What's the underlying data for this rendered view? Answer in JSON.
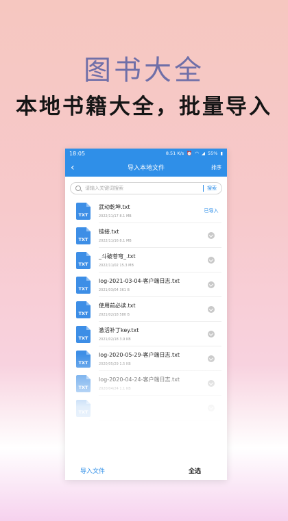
{
  "promo": {
    "title": "图书大全",
    "subtitle": "本地书籍大全，批量导入"
  },
  "status_bar": {
    "time": "18:05",
    "speed": "8.51 K/s",
    "battery": "55%"
  },
  "nav": {
    "back_icon": "chevron-left-icon",
    "title": "导入本地文件",
    "sort_label": "排序"
  },
  "search": {
    "placeholder": "请输入关键词搜索",
    "button_label": "搜索"
  },
  "files": [
    {
      "icon_label": "TXT",
      "name": "武动乾坤.txt",
      "meta": "2022/11/17  8.1 MB",
      "status": "imported",
      "status_label": "已导入"
    },
    {
      "icon_label": "TXT",
      "name": "链接.txt",
      "meta": "2022/11/16  8.1 MB",
      "status": "check"
    },
    {
      "icon_label": "TXT",
      "name": "_斗破苍穹_.txt",
      "meta": "2022/11/02  15.3 MB",
      "status": "check"
    },
    {
      "icon_label": "TXT",
      "name": "log-2021-03-04-客户端日志.txt",
      "meta": "2021/03/04  361 B",
      "status": "check"
    },
    {
      "icon_label": "TXT",
      "name": "使用前必读.txt",
      "meta": "2021/02/18  580 B",
      "status": "check"
    },
    {
      "icon_label": "TXT",
      "name": "激活补丁key.txt",
      "meta": "2021/02/18  3.9 KB",
      "status": "check"
    },
    {
      "icon_label": "TXT",
      "name": "log-2020-05-29-客户端日志.txt",
      "meta": "2020/05/29  1.5 KB",
      "status": "check"
    },
    {
      "icon_label": "TXT",
      "name": "log-2020-04-24-客户端日志.txt",
      "meta": "2020/04/24  1.1 KB",
      "status": "check"
    },
    {
      "icon_label": "TXT",
      "name": "",
      "meta": "",
      "status": "check"
    }
  ],
  "bottom": {
    "import_label": "导入文件",
    "select_all_label": "全选"
  },
  "colors": {
    "accent": "#2f8fe8",
    "promo_title": "#6f6fa8"
  }
}
